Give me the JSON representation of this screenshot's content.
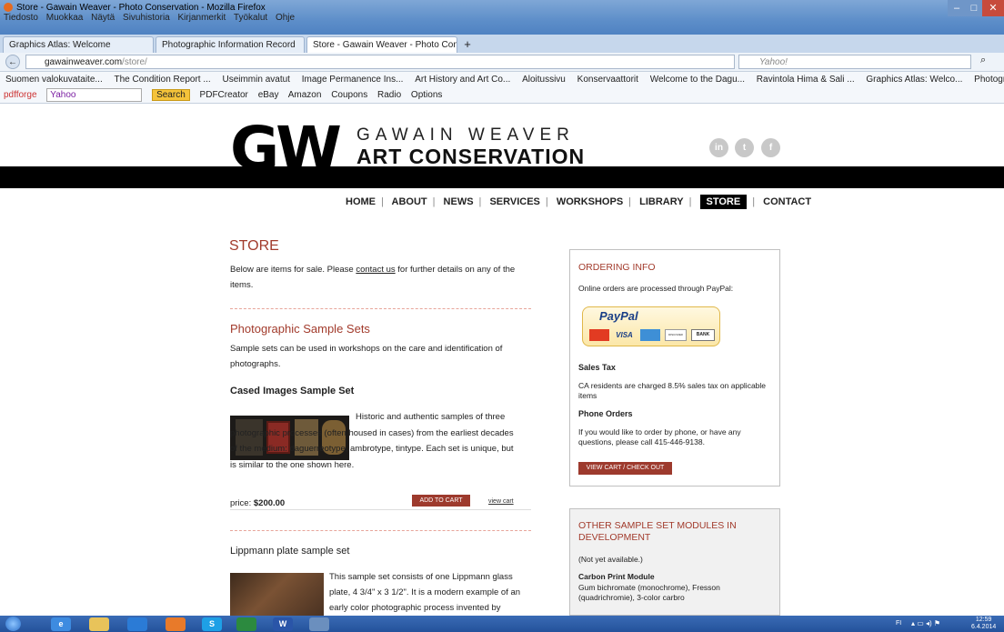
{
  "window": {
    "title": "Store - Gawain Weaver - Photo Conservation - Mozilla Firefox",
    "menu": [
      "Tiedosto",
      "Muokkaa",
      "Näytä",
      "Sivuhistoria",
      "Kirjanmerkit",
      "Työkalut",
      "Ohje"
    ]
  },
  "tabs": [
    {
      "label": "Graphics Atlas: Welcome"
    },
    {
      "label": "Photographic Information Record"
    },
    {
      "label": "Store - Gawain Weaver - Photo Conse..."
    }
  ],
  "nav": {
    "url_host": "gawainweaver.com",
    "url_path": "/store/",
    "search_engine": "Yahoo!",
    "bookmarks": [
      "Suomen valokuvataite...",
      "The Condition Report ...",
      "Useimmin avatut",
      "Image Permanence Ins...",
      "Art History and Art Co...",
      "Aloitussivu",
      "Konservaattorit",
      "Welcome to the Dagu...",
      "Ravintola Hima & Sali ...",
      "Graphics Atlas: Welco...",
      "Photograph Conservat..."
    ],
    "toolbar": {
      "pdfforge": "pdfforge",
      "yahoo": "Yahoo",
      "search": "Search",
      "items": [
        "PDFCreator",
        "eBay",
        "Amazon",
        "Coupons",
        "Radio",
        "Options"
      ]
    }
  },
  "site": {
    "logo_mark": "GW",
    "logo_top": "GAWAIN WEAVER",
    "logo_bottom": "ART CONSERVATION",
    "social": [
      "in",
      "t",
      "f"
    ],
    "menu": [
      "HOME",
      "ABOUT",
      "NEWS",
      "SERVICES",
      "WORKSHOPS",
      "LIBRARY",
      "STORE",
      "CONTACT"
    ]
  },
  "main": {
    "heading": "STORE",
    "intro_a": "Below are items for sale. Please ",
    "intro_link": "contact us",
    "intro_b": " for further details on any of the items.",
    "section_h": "Photographic Sample Sets",
    "section_p": "Sample sets can be used in workshops on the care and identification of photographs.",
    "item1_h": "Cased Images Sample Set",
    "item1_p": "Historic and authentic samples of three photographic processes (often housed in cases) from the earliest decades of the medium: daguerreotype, ambrotype, tintype. Each set is unique, but is similar to the one shown here.",
    "price_label": "price: ",
    "price": "$200.00",
    "add_to_cart": "ADD TO CART",
    "view_cart": "view cart",
    "item2_h": "Lippmann plate sample set",
    "item2_p": "This sample set consists of one Lippmann glass plate, 4 3/4\" x 3 1/2\". It is a modern example of an early color photographic process invented by"
  },
  "sidebar": {
    "order_h": "ORDERING INFO",
    "order_p": "Online orders are processed through PayPal:",
    "paypal": "PayPal",
    "cards": [
      "VISA",
      "DISCOVER",
      "BANK"
    ],
    "tax_h": "Sales Tax",
    "tax_p": "CA residents are charged 8.5% sales tax on applicable items",
    "phone_h": "Phone Orders",
    "phone_p": "If you would like to order by phone, or have any questions, please call 415-446-9138.",
    "checkout": "VIEW CART / CHECK OUT",
    "other_h": "OTHER SAMPLE SET MODULES IN DEVELOPMENT",
    "other_note": "(Not yet available.)",
    "carbon_h": "Carbon Print Module",
    "carbon_p": "Gum bichromate (monochrome), Fresson (quadrichromie), 3-color carbro"
  },
  "taskbar": {
    "apps": [
      "e",
      "S",
      "W"
    ],
    "lang": "FI",
    "time": "12:59",
    "date": "6.4.2014"
  }
}
